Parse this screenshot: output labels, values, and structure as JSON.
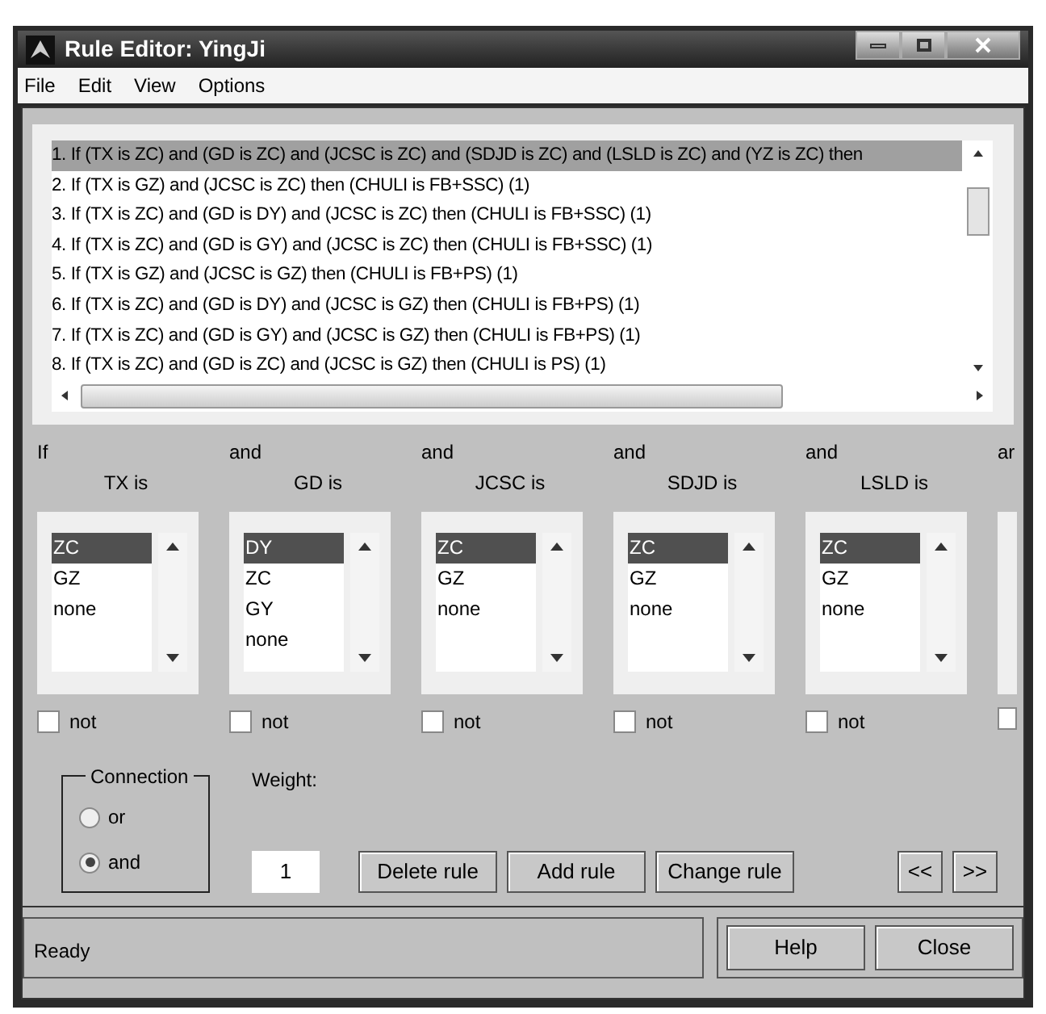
{
  "window": {
    "title": "Rule Editor: YingJi"
  },
  "menu": [
    "File",
    "Edit",
    "View",
    "Options"
  ],
  "rules": [
    {
      "text": "1. If (TX is ZC) and (GD is ZC) and (JCSC is ZC) and (SDJD is ZC) and (LSLD is ZC) and (YZ is ZC) then",
      "selected": true
    },
    {
      "text": "2. If (TX is GZ) and (JCSC is ZC) then (CHULI is FB+SSC) (1)",
      "selected": false
    },
    {
      "text": "3. If (TX is ZC) and (GD is DY) and (JCSC is ZC) then (CHULI is FB+SSC) (1)",
      "selected": false
    },
    {
      "text": "4. If (TX is ZC) and (GD is GY) and (JCSC is ZC) then (CHULI is FB+SSC) (1)",
      "selected": false
    },
    {
      "text": "5. If (TX is GZ) and (JCSC is GZ) then (CHULI is FB+PS) (1)",
      "selected": false
    },
    {
      "text": "6. If (TX is ZC) and (GD is DY) and (JCSC is GZ) then (CHULI is FB+PS) (1)",
      "selected": false
    },
    {
      "text": "7. If (TX is ZC) and (GD is GY) and (JCSC is GZ) then (CHULI is FB+PS) (1)",
      "selected": false
    },
    {
      "text": "8. If (TX is ZC) and (GD is ZC) and (JCSC is GZ) then (CHULI is PS) (1)",
      "selected": false
    }
  ],
  "variables": [
    {
      "kind": "full",
      "prefix": "If",
      "label": "TX is",
      "options": [
        {
          "text": "ZC",
          "selected": true
        },
        {
          "text": "GZ",
          "selected": false
        },
        {
          "text": "none",
          "selected": false
        }
      ],
      "not_label": "not",
      "not_checked": false
    },
    {
      "kind": "full",
      "prefix": "and",
      "label": "GD is",
      "options": [
        {
          "text": "DY",
          "selected": true
        },
        {
          "text": "ZC",
          "selected": false
        },
        {
          "text": "GY",
          "selected": false
        },
        {
          "text": "none",
          "selected": false
        }
      ],
      "not_label": "not",
      "not_checked": false
    },
    {
      "kind": "full",
      "prefix": "and",
      "label": "JCSC is",
      "options": [
        {
          "text": "ZC",
          "selected": true
        },
        {
          "text": "GZ",
          "selected": false
        },
        {
          "text": "none",
          "selected": false
        }
      ],
      "not_label": "not",
      "not_checked": false
    },
    {
      "kind": "full",
      "prefix": "and",
      "label": "SDJD is",
      "options": [
        {
          "text": "ZC",
          "selected": true
        },
        {
          "text": "GZ",
          "selected": false
        },
        {
          "text": "none",
          "selected": false
        }
      ],
      "not_label": "not",
      "not_checked": false
    },
    {
      "kind": "full",
      "prefix": "and",
      "label": "LSLD is",
      "options": [
        {
          "text": "ZC",
          "selected": true
        },
        {
          "text": "GZ",
          "selected": false
        },
        {
          "text": "none",
          "selected": false
        }
      ],
      "not_label": "not",
      "not_checked": false
    },
    {
      "kind": "partial",
      "prefix": "ar",
      "not_checked": false
    }
  ],
  "connection": {
    "title": "Connection",
    "options": [
      {
        "label": "or",
        "selected": false
      },
      {
        "label": "and",
        "selected": true
      }
    ]
  },
  "weight": {
    "label": "Weight:",
    "value": "1"
  },
  "rule_buttons": [
    "Delete rule",
    "Add rule",
    "Change rule"
  ],
  "nav_buttons": [
    "<<",
    ">>"
  ],
  "status": "Ready",
  "footer_buttons": [
    "Help",
    "Close"
  ]
}
